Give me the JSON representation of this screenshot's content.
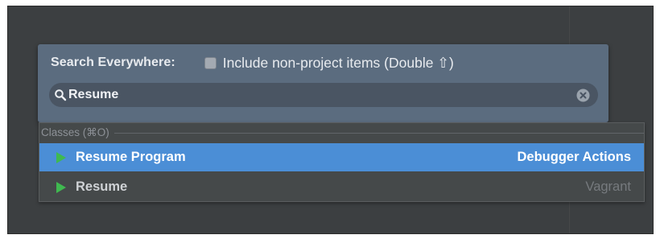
{
  "popup": {
    "title": "Search Everywhere:",
    "include_label": "Include non-project items (Double ⇧)",
    "include_checked": false
  },
  "search": {
    "value": "Resume",
    "icon": "search-icon",
    "clear_icon": "clear-icon"
  },
  "results": {
    "group_label": "Classes (⌘O)",
    "items": [
      {
        "name": "Resume Program",
        "location": "Debugger Actions",
        "icon": "run-icon",
        "selected": true
      },
      {
        "name": "Resume",
        "location": "Vagrant",
        "icon": "run-icon",
        "selected": false
      }
    ]
  },
  "colors": {
    "popup_bg": "#5b6c7f",
    "selection": "#4b8ed6",
    "run_icon": "#3fb950",
    "ide_bg": "#3c3f41"
  }
}
